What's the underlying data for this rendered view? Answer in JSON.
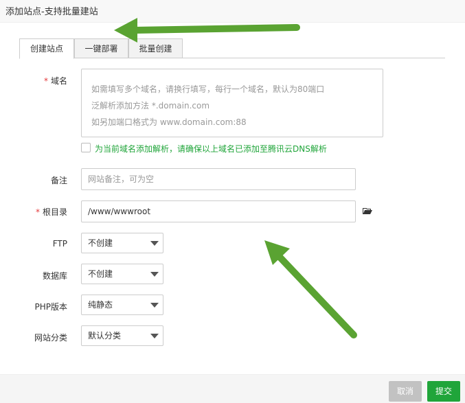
{
  "window": {
    "title": "添加站点-支持批量建站"
  },
  "tabs": [
    {
      "label": "创建站点",
      "active": true
    },
    {
      "label": "一键部署",
      "active": false
    },
    {
      "label": "批量创建",
      "active": false
    }
  ],
  "form": {
    "domain": {
      "label": "域名",
      "required_mark": "*",
      "placeholder_lines": [
        "如需填写多个域名，请换行填写，每行一个域名，默认为80端口",
        "泛解析添加方法 *.domain.com",
        "如另加端口格式为 www.domain.com:88"
      ]
    },
    "dns_checkbox": {
      "label": "为当前域名添加解析，请确保以上域名已添加至腾讯云DNS解析",
      "checked": false
    },
    "remark": {
      "label": "备注",
      "placeholder": "网站备注，可为空"
    },
    "root": {
      "label": "根目录",
      "required_mark": "*",
      "value": "/www/wwwroot"
    },
    "ftp": {
      "label": "FTP",
      "selected": "不创建"
    },
    "database": {
      "label": "数据库",
      "selected": "不创建"
    },
    "php": {
      "label": "PHP版本",
      "selected": "纯静态"
    },
    "category": {
      "label": "网站分类",
      "selected": "默认分类"
    }
  },
  "footer": {
    "cancel_label": "取消",
    "submit_label": "提交"
  },
  "colors": {
    "accent": "#20a53a",
    "required": "#e4393c",
    "cancel": "#c2c2c2",
    "annotation_arrow": "#5aa332"
  },
  "icons": {
    "folder": "folder-open-icon"
  }
}
